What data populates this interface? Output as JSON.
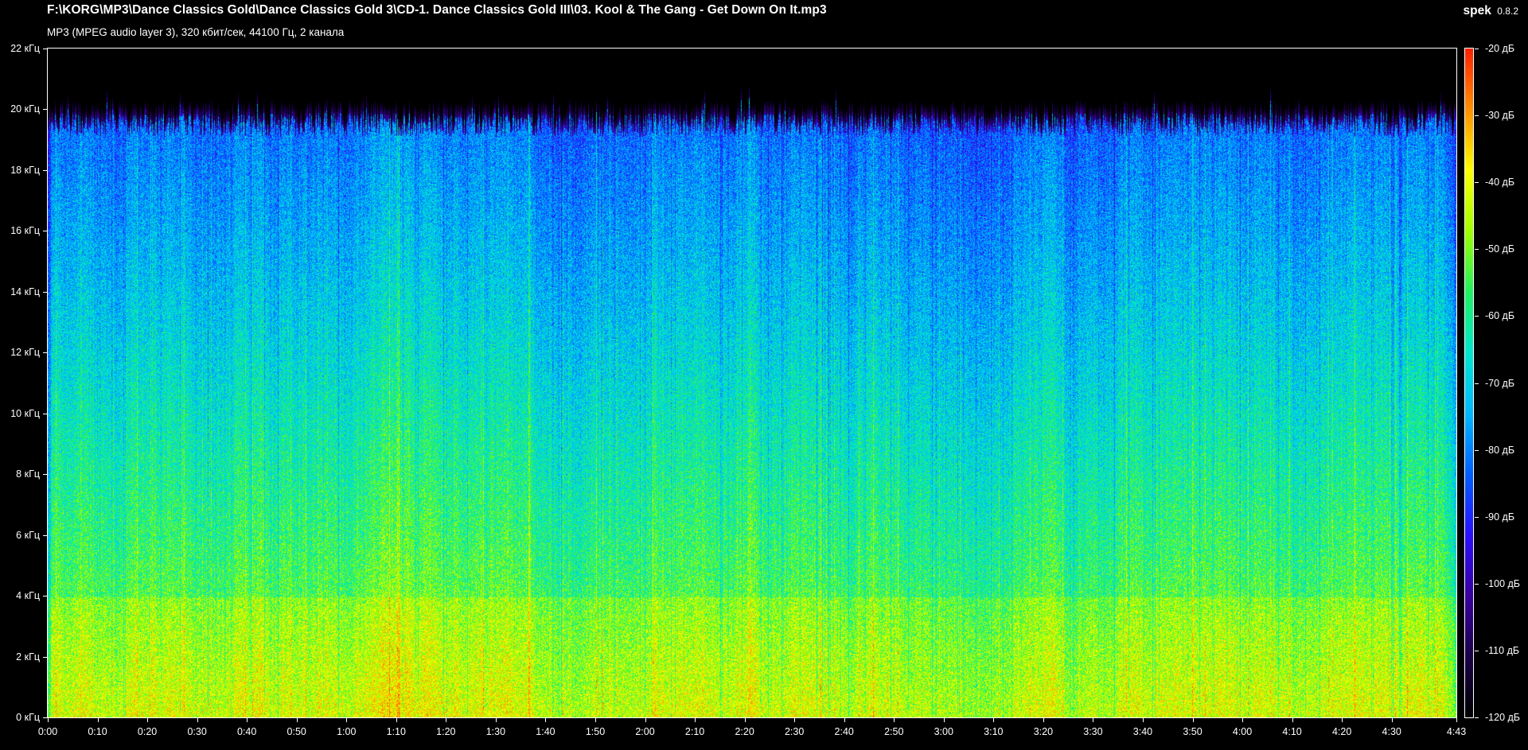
{
  "header": {
    "file_path": "F:\\KORG\\MP3\\Dance Classics Gold\\Dance Classics Gold 3\\CD-1. Dance Classics Gold III\\03. Kool & The Gang - Get Down On It.mp3",
    "file_info": "MP3 (MPEG audio layer 3), 320 кбит/сек, 44100 Гц, 2 канала",
    "app_name": "spek",
    "app_version": "0.8.2"
  },
  "frequency_axis": {
    "labels": [
      "22 кГц",
      "20 кГц",
      "18 кГц",
      "16 кГц",
      "14 кГц",
      "12 кГц",
      "10 кГц",
      "8 кГц",
      "6 кГц",
      "4 кГц",
      "2 кГц",
      "0 кГц"
    ],
    "values_khz": [
      22,
      20,
      18,
      16,
      14,
      12,
      10,
      8,
      6,
      4,
      2,
      0
    ],
    "max_khz": 22
  },
  "time_axis": {
    "labels": [
      "0:00",
      "0:10",
      "0:20",
      "0:30",
      "0:40",
      "0:50",
      "1:00",
      "1:10",
      "1:20",
      "1:30",
      "1:40",
      "1:50",
      "2:00",
      "2:10",
      "2:20",
      "2:30",
      "2:40",
      "2:50",
      "3:00",
      "3:10",
      "3:20",
      "3:30",
      "3:40",
      "3:50",
      "4:00",
      "4:10",
      "4:20",
      "4:30",
      "4:43"
    ],
    "values_sec": [
      0,
      10,
      20,
      30,
      40,
      50,
      60,
      70,
      80,
      90,
      100,
      110,
      120,
      130,
      140,
      150,
      160,
      170,
      180,
      190,
      200,
      210,
      220,
      230,
      240,
      250,
      260,
      270,
      283
    ],
    "duration_sec": 283
  },
  "level_scale": {
    "labels": [
      "-20 дБ",
      "-30 дБ",
      "-40 дБ",
      "-50 дБ",
      "-60 дБ",
      "-70 дБ",
      "-80 дБ",
      "-90 дБ",
      "-100 дБ",
      "-110 дБ",
      "-120 дБ"
    ],
    "values_db": [
      -20,
      -30,
      -40,
      -50,
      -60,
      -70,
      -80,
      -90,
      -100,
      -110,
      -120
    ],
    "max_db": -20,
    "min_db": -120
  },
  "spectrogram": {
    "cutoff_khz": 19.5,
    "palette": [
      "#000000",
      "#1a0048",
      "#3a00a0",
      "#2a10ff",
      "#0060ff",
      "#00b8ff",
      "#00e8d0",
      "#20f060",
      "#a0ff00",
      "#ffff00",
      "#ff9000",
      "#ff2000"
    ]
  }
}
